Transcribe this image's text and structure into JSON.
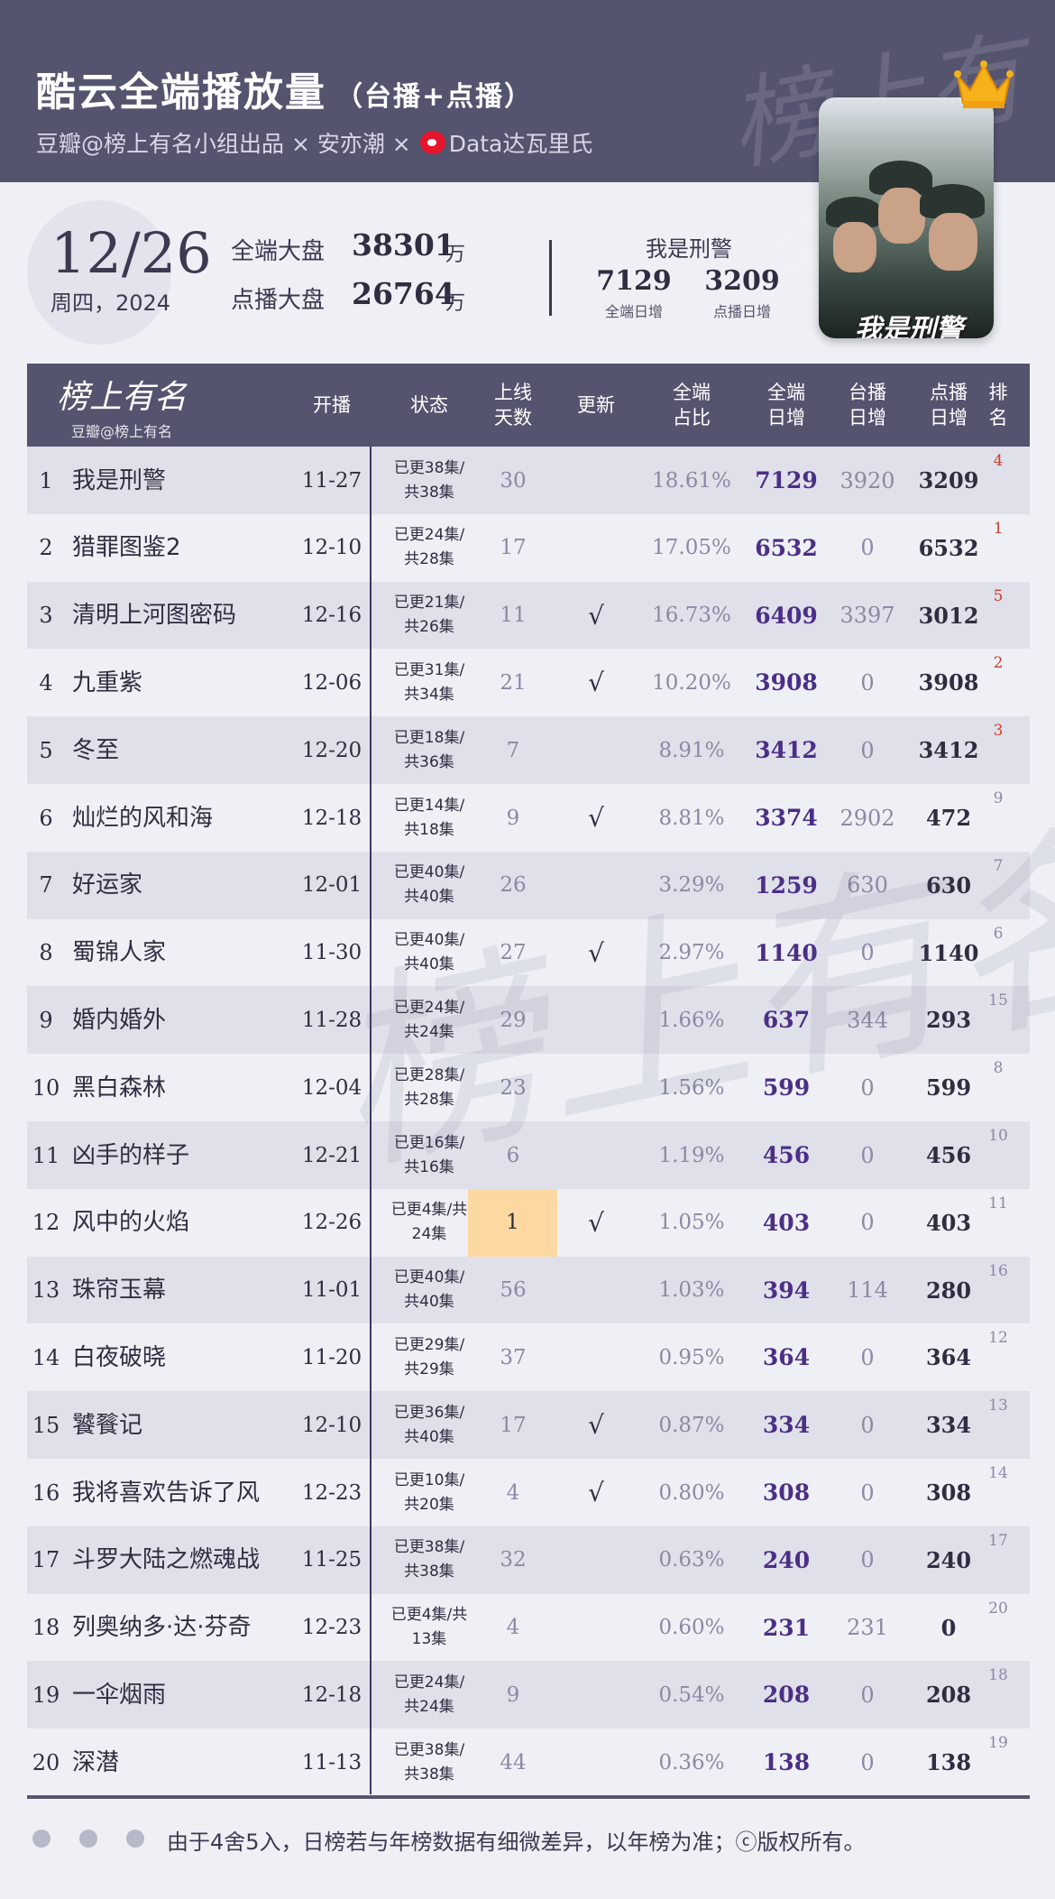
{
  "header": {
    "title": "酷云全端播放量",
    "title_sub": "（台播+点播）",
    "credit_part1": "豆瓣@榜上有名小组出品 × 安亦潮 × ",
    "credit_part2": "Data达瓦里氏",
    "watermark": "榜上有名",
    "colors": {
      "header_bg": "#55546f",
      "accent_purple": "#4b2f86",
      "rank_up_red": "#d43a2a",
      "highlight": "#fdd8a0"
    }
  },
  "poster": {
    "title": "我是刑警",
    "icon": "crown-icon"
  },
  "summary": {
    "date": "12/26",
    "weekday": "周四，2024",
    "all_label": "全端大盘",
    "all_value": "38301",
    "all_unit": "万",
    "vod_label": "点播大盘",
    "vod_value": "26764",
    "vod_unit": "万"
  },
  "featured": {
    "name": "我是刑警",
    "all_value": "7129",
    "all_label": "全端日增",
    "vod_value": "3209",
    "vod_label": "点播日增"
  },
  "table": {
    "logo_text": "榜上有名",
    "logo_sub": "豆瓣@榜上有名",
    "headers": {
      "start": "开播",
      "status": "状态",
      "days_1": "上线",
      "days_2": "天数",
      "update": "更新",
      "share_1": "全端",
      "share_2": "占比",
      "all_1": "全端",
      "all_2": "日增",
      "tv_1": "台播",
      "tv_2": "日增",
      "vod_1": "点播",
      "vod_2": "日增",
      "prev_1": "排",
      "prev_2": "名"
    },
    "rows": [
      {
        "rank": "1",
        "name": "我是刑警",
        "start": "11-27",
        "status_1": "已更38集/",
        "status_2": "共38集",
        "days": "30",
        "update": "",
        "share": "18.61%",
        "all": "7129",
        "tv": "3920",
        "vod": "3209",
        "prev": "4",
        "prev_up": true
      },
      {
        "rank": "2",
        "name": "猎罪图鉴2",
        "start": "12-10",
        "status_1": "已更24集/",
        "status_2": "共28集",
        "days": "17",
        "update": "",
        "share": "17.05%",
        "all": "6532",
        "tv": "0",
        "vod": "6532",
        "prev": "1",
        "prev_up": true
      },
      {
        "rank": "3",
        "name": "清明上河图密码",
        "start": "12-16",
        "status_1": "已更21集/",
        "status_2": "共26集",
        "days": "11",
        "update": "√",
        "share": "16.73%",
        "all": "6409",
        "tv": "3397",
        "vod": "3012",
        "prev": "5",
        "prev_up": true
      },
      {
        "rank": "4",
        "name": "九重紫",
        "start": "12-06",
        "status_1": "已更31集/",
        "status_2": "共34集",
        "days": "21",
        "update": "√",
        "share": "10.20%",
        "all": "3908",
        "tv": "0",
        "vod": "3908",
        "prev": "2",
        "prev_up": true
      },
      {
        "rank": "5",
        "name": "冬至",
        "start": "12-20",
        "status_1": "已更18集/",
        "status_2": "共36集",
        "days": "7",
        "update": "",
        "share": "8.91%",
        "all": "3412",
        "tv": "0",
        "vod": "3412",
        "prev": "3",
        "prev_up": true
      },
      {
        "rank": "6",
        "name": "灿烂的风和海",
        "start": "12-18",
        "status_1": "已更14集/",
        "status_2": "共18集",
        "days": "9",
        "update": "√",
        "share": "8.81%",
        "all": "3374",
        "tv": "2902",
        "vod": "472",
        "prev": "9",
        "prev_up": false
      },
      {
        "rank": "7",
        "name": "好运家",
        "start": "12-01",
        "status_1": "已更40集/",
        "status_2": "共40集",
        "days": "26",
        "update": "",
        "share": "3.29%",
        "all": "1259",
        "tv": "630",
        "vod": "630",
        "prev": "7",
        "prev_up": false
      },
      {
        "rank": "8",
        "name": "蜀锦人家",
        "start": "11-30",
        "status_1": "已更40集/",
        "status_2": "共40集",
        "days": "27",
        "update": "√",
        "share": "2.97%",
        "all": "1140",
        "tv": "0",
        "vod": "1140",
        "prev": "6",
        "prev_up": false
      },
      {
        "rank": "9",
        "name": "婚内婚外",
        "start": "11-28",
        "status_1": "已更24集/",
        "status_2": "共24集",
        "days": "29",
        "update": "",
        "share": "1.66%",
        "all": "637",
        "tv": "344",
        "vod": "293",
        "prev": "15",
        "prev_up": false
      },
      {
        "rank": "10",
        "name": "黑白森林",
        "start": "12-04",
        "status_1": "已更28集/",
        "status_2": "共28集",
        "days": "23",
        "update": "",
        "share": "1.56%",
        "all": "599",
        "tv": "0",
        "vod": "599",
        "prev": "8",
        "prev_up": false
      },
      {
        "rank": "11",
        "name": "凶手的样子",
        "start": "12-21",
        "status_1": "已更16集/",
        "status_2": "共16集",
        "days": "6",
        "update": "",
        "share": "1.19%",
        "all": "456",
        "tv": "0",
        "vod": "456",
        "prev": "10",
        "prev_up": false
      },
      {
        "rank": "12",
        "name": "风中的火焰",
        "start": "12-26",
        "status_1": "已更4集/共",
        "status_2": "24集",
        "days": "1",
        "update": "√",
        "share": "1.05%",
        "all": "403",
        "tv": "0",
        "vod": "403",
        "prev": "11",
        "prev_up": false,
        "highlight": true
      },
      {
        "rank": "13",
        "name": "珠帘玉幕",
        "start": "11-01",
        "status_1": "已更40集/",
        "status_2": "共40集",
        "days": "56",
        "update": "",
        "share": "1.03%",
        "all": "394",
        "tv": "114",
        "vod": "280",
        "prev": "16",
        "prev_up": false
      },
      {
        "rank": "14",
        "name": "白夜破晓",
        "start": "11-20",
        "status_1": "已更29集/",
        "status_2": "共29集",
        "days": "37",
        "update": "",
        "share": "0.95%",
        "all": "364",
        "tv": "0",
        "vod": "364",
        "prev": "12",
        "prev_up": false
      },
      {
        "rank": "15",
        "name": "饕餮记",
        "start": "12-10",
        "status_1": "已更36集/",
        "status_2": "共40集",
        "days": "17",
        "update": "√",
        "share": "0.87%",
        "all": "334",
        "tv": "0",
        "vod": "334",
        "prev": "13",
        "prev_up": false
      },
      {
        "rank": "16",
        "name": "我将喜欢告诉了风",
        "start": "12-23",
        "status_1": "已更10集/",
        "status_2": "共20集",
        "days": "4",
        "update": "√",
        "share": "0.80%",
        "all": "308",
        "tv": "0",
        "vod": "308",
        "prev": "14",
        "prev_up": false
      },
      {
        "rank": "17",
        "name": "斗罗大陆之燃魂战",
        "start": "11-25",
        "status_1": "已更38集/",
        "status_2": "共38集",
        "days": "32",
        "update": "",
        "share": "0.63%",
        "all": "240",
        "tv": "0",
        "vod": "240",
        "prev": "17",
        "prev_up": false
      },
      {
        "rank": "18",
        "name": "列奥纳多·达·芬奇",
        "start": "12-23",
        "status_1": "已更4集/共",
        "status_2": "13集",
        "days": "4",
        "update": "",
        "share": "0.60%",
        "all": "231",
        "tv": "231",
        "vod": "0",
        "prev": "20",
        "prev_up": false
      },
      {
        "rank": "19",
        "name": "一伞烟雨",
        "start": "12-18",
        "status_1": "已更24集/",
        "status_2": "共24集",
        "days": "9",
        "update": "",
        "share": "0.54%",
        "all": "208",
        "tv": "0",
        "vod": "208",
        "prev": "18",
        "prev_up": false
      },
      {
        "rank": "20",
        "name": "深潜",
        "start": "11-13",
        "status_1": "已更38集/",
        "status_2": "共38集",
        "days": "44",
        "update": "",
        "share": "0.36%",
        "all": "138",
        "tv": "0",
        "vod": "138",
        "prev": "19",
        "prev_up": false
      }
    ]
  },
  "footer": {
    "note": "由于4舍5入，日榜若与年榜数据有细微差异，以年榜为准；ⓒ版权所有。"
  }
}
